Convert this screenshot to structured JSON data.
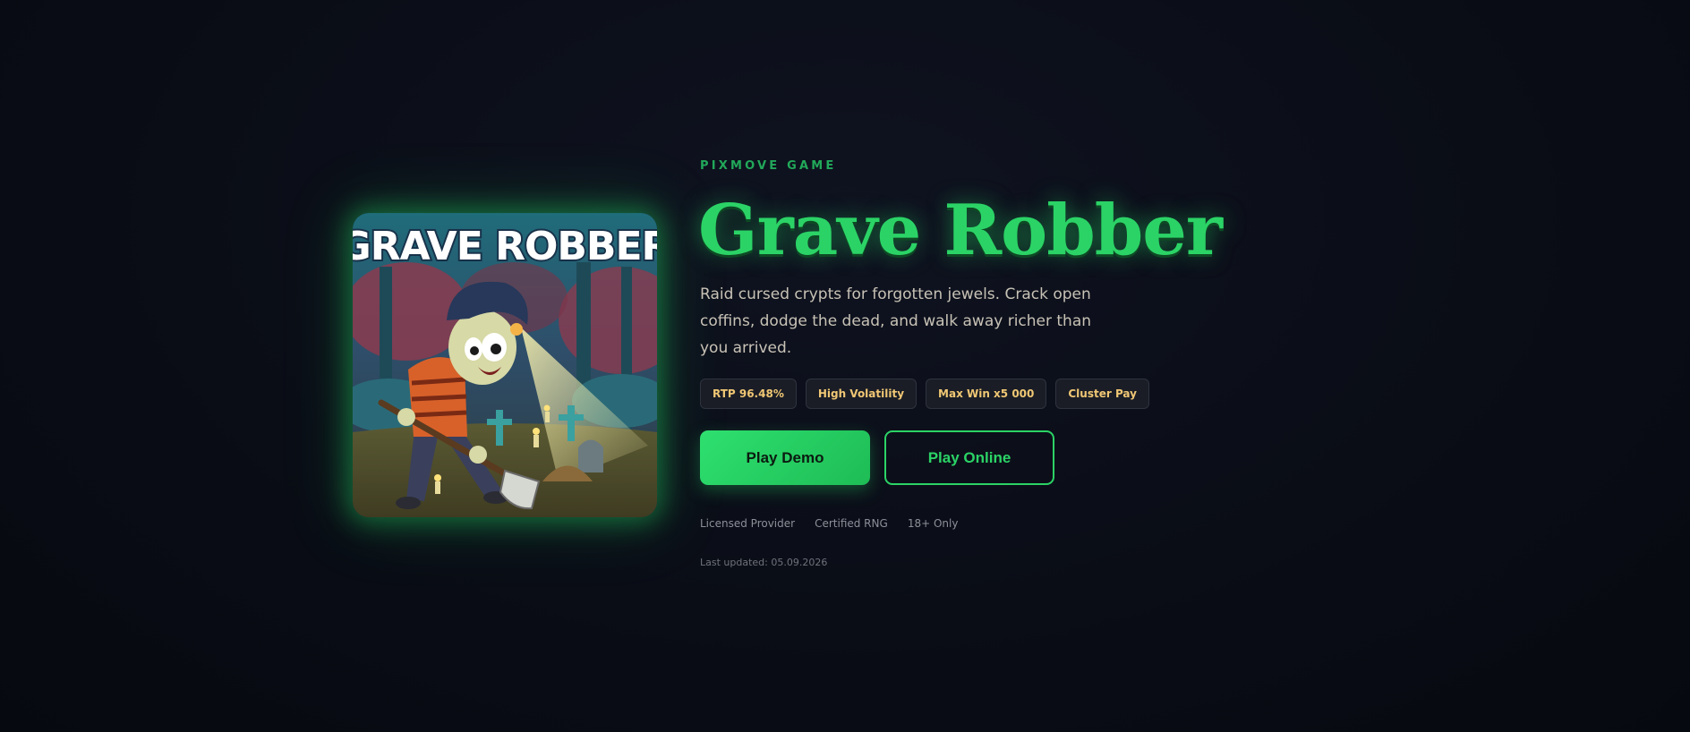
{
  "provider": "PIXMOVE GAME",
  "title": "Grave Robber",
  "description": "Raid cursed crypts for forgotten jewels. Crack open coffins, dodge the dead, and walk away richer than you arrived.",
  "cover": {
    "logo_text": "GRAVE ROBBER",
    "alt": "Grave Robber"
  },
  "badges": [
    "RTP 96.48%",
    "High Volatility",
    "Max Win x5 000",
    "Cluster Pay"
  ],
  "buttons": {
    "demo": "Play Demo",
    "online": "Play Online"
  },
  "trust": [
    "Licensed Provider",
    "Certified RNG",
    "18+ Only"
  ],
  "updated": "Last updated: 05.09.2026",
  "colors": {
    "accent": "#2bd366",
    "badge_text": "#f0c774",
    "background": "#0a0d16"
  }
}
